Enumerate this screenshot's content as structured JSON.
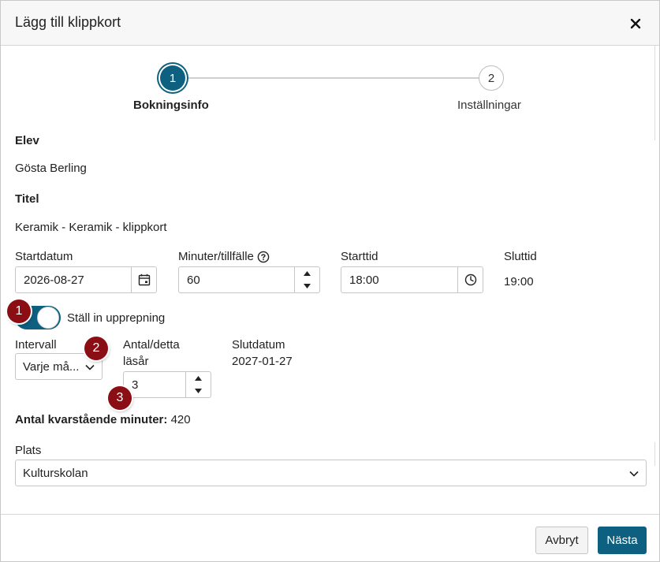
{
  "dialog": {
    "title": "Lägg till klippkort"
  },
  "stepper": {
    "steps": [
      {
        "number": "1",
        "label": "Bokningsinfo"
      },
      {
        "number": "2",
        "label": "Inställningar"
      }
    ]
  },
  "student": {
    "label": "Elev",
    "value": "Gösta Berling"
  },
  "course": {
    "label": "Titel",
    "value": "Keramik - Keramik - klippkort"
  },
  "schedule": {
    "start_date_label": "Startdatum",
    "start_date_value": "2026-08-27",
    "minutes_label": "Minuter/tillfälle",
    "minutes_value": "60",
    "start_time_label": "Starttid",
    "start_time_value": "18:00",
    "end_time_label": "Sluttid",
    "end_time_value": "19:00"
  },
  "repeat": {
    "toggle_label": "Ställ in upprepning",
    "enabled": true,
    "interval_label": "Intervall",
    "interval_value": "Varje må...",
    "count_label_line1": "Antal/detta",
    "count_label_line2": "läsår",
    "count_value": "3",
    "end_date_label": "Slutdatum",
    "end_date_value": "2027-01-27"
  },
  "remaining": {
    "label": "Antal kvarstående minuter:",
    "value": "420"
  },
  "location": {
    "label": "Plats",
    "value": "Kulturskolan"
  },
  "badges": [
    "1",
    "2",
    "3"
  ],
  "footer": {
    "cancel_label": "Avbryt",
    "next_label": "Nästa"
  },
  "colors": {
    "accent": "#0e6080",
    "badge": "#8b0e15"
  }
}
